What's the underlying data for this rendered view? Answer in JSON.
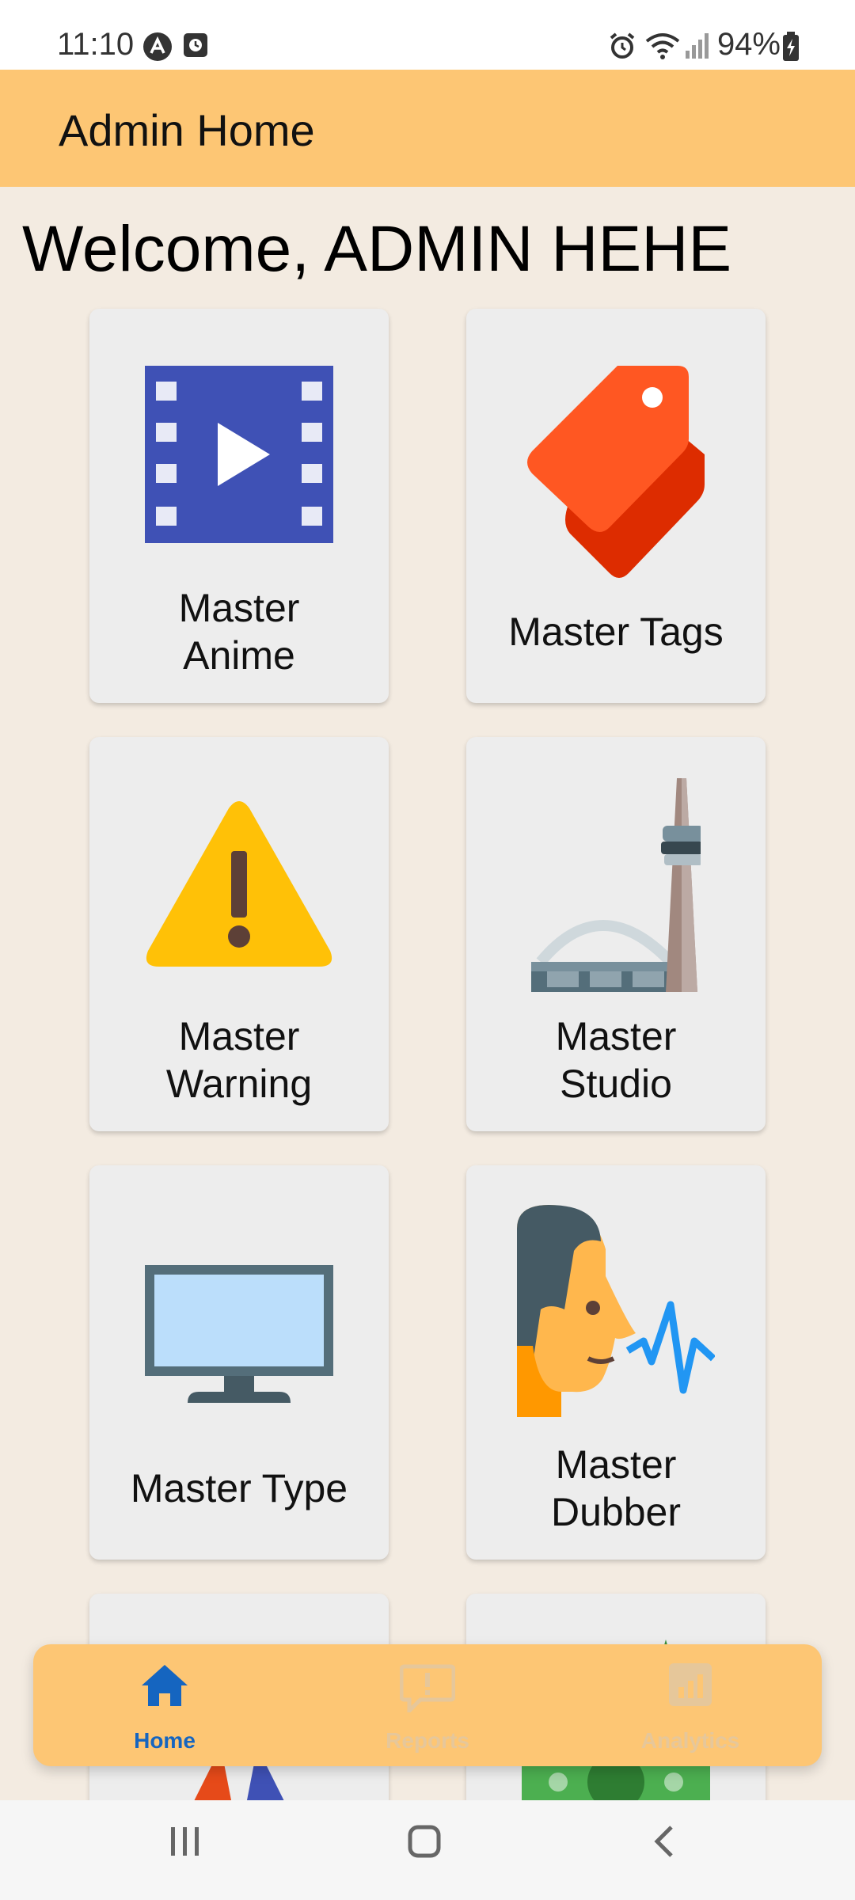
{
  "status_bar": {
    "time": "11:10",
    "battery": "94%",
    "icons": [
      "a-logo-icon",
      "clock-app-icon",
      "alarm-icon",
      "wifi-icon",
      "signal-icon",
      "battery-charging-icon"
    ]
  },
  "app_bar": {
    "title": "Admin Home"
  },
  "welcome": "Welcome, ADMIN HEHE",
  "menu_cards": [
    {
      "label": "Master\nAnime",
      "icon": "film-play-icon"
    },
    {
      "label": "Master Tags",
      "icon": "tags-icon"
    },
    {
      "label": "Master\nWarning",
      "icon": "warning-icon"
    },
    {
      "label": "Master\nStudio",
      "icon": "stadium-tower-icon"
    },
    {
      "label": "Master Type",
      "icon": "monitor-icon"
    },
    {
      "label": "Master\nDubber",
      "icon": "voice-actor-icon"
    }
  ],
  "bottom_nav": {
    "items": [
      {
        "label": "Home",
        "icon": "home-icon",
        "active": true
      },
      {
        "label": "Reports",
        "icon": "report-icon",
        "active": false
      },
      {
        "label": "Analytics",
        "icon": "analytics-icon",
        "active": false
      }
    ],
    "active_color": "#1565C0",
    "inactive_color": "#E6C79A"
  },
  "colors": {
    "app_bar": "#FDC674",
    "background": "#F3EBE1",
    "card": "#EDEDED"
  }
}
